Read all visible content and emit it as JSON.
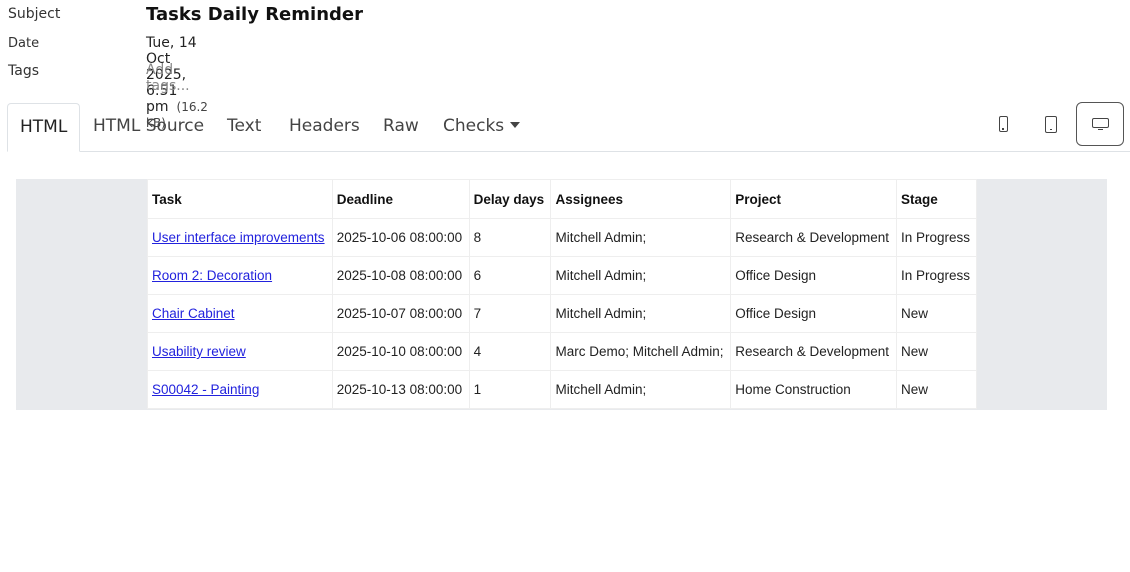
{
  "meta": {
    "subject_label": "Subject",
    "subject": "Tasks Daily Reminder",
    "date_label": "Date",
    "date": "Tue, 14 Oct 2025, 6:51 pm",
    "size": "(16.2 kB)",
    "tags_label": "Tags",
    "tags_placeholder": "Add tags..."
  },
  "tabs": [
    {
      "label": "HTML",
      "active": true
    },
    {
      "label": "HTML Source"
    },
    {
      "label": "Text"
    },
    {
      "label": "Headers"
    },
    {
      "label": "Raw"
    },
    {
      "label": "Checks"
    }
  ],
  "device_buttons": [
    {
      "icon": "phone-icon"
    },
    {
      "icon": "tablet-icon"
    },
    {
      "icon": "desktop-icon",
      "active": true
    }
  ],
  "table": {
    "headers": [
      "Task",
      "Deadline",
      "Delay days",
      "Assignees",
      "Project",
      "Stage"
    ],
    "rows": [
      {
        "task": "User interface improvements",
        "deadline": "2025-10-06 08:00:00",
        "delay": "8",
        "assignees": "Mitchell Admin;",
        "project": "Research & Development",
        "stage": "In Progress"
      },
      {
        "task": "Room 2: Decoration",
        "deadline": "2025-10-08 08:00:00",
        "delay": "6",
        "assignees": "Mitchell Admin;",
        "project": "Office Design",
        "stage": "In Progress"
      },
      {
        "task": "Chair Cabinet",
        "deadline": "2025-10-07 08:00:00",
        "delay": "7",
        "assignees": "Mitchell Admin;",
        "project": "Office Design",
        "stage": "New"
      },
      {
        "task": "Usability review",
        "deadline": "2025-10-10 08:00:00",
        "delay": "4",
        "assignees": "Marc Demo; Mitchell Admin;",
        "project": "Research & Development",
        "stage": "New"
      },
      {
        "task": "S00042 - Painting",
        "deadline": "2025-10-13 08:00:00",
        "delay": "1",
        "assignees": "Mitchell Admin;",
        "project": "Home Construction",
        "stage": "New"
      }
    ]
  }
}
